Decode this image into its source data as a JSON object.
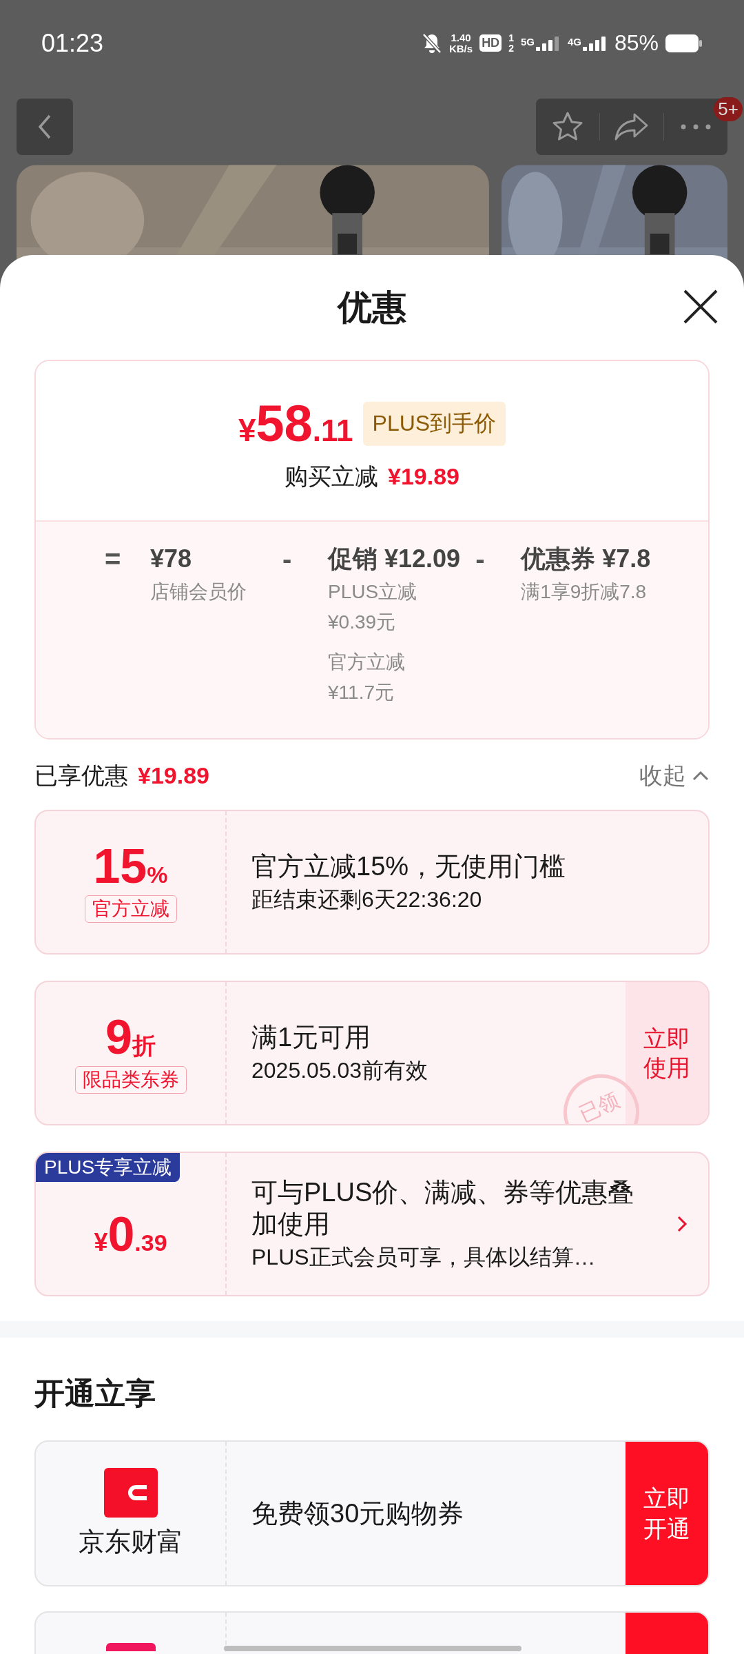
{
  "status_bar": {
    "time": "01:23",
    "net_speed": "1.40",
    "net_unit": "KB/s",
    "hd": "HD",
    "sim_slots": [
      "1",
      "2"
    ],
    "networks": [
      "5G",
      "4G"
    ],
    "battery": "85%"
  },
  "nav": {
    "badge": "5+"
  },
  "sheet": {
    "title": "优惠"
  },
  "price_summary": {
    "currency": "¥",
    "integer": "58",
    "decimal": ".11",
    "tag": "PLUS到手价",
    "saving_label": "购买立减",
    "saving_amount": "¥19.89"
  },
  "breakdown": [
    {
      "operator": "=",
      "value": "¥78",
      "notes": [
        [
          "店铺会员价"
        ]
      ]
    },
    {
      "operator": "-",
      "label": "促销",
      "value": "¥12.09",
      "notes": [
        [
          "PLUS立减",
          "¥0.39元"
        ],
        [
          "官方立减",
          "¥11.7元"
        ]
      ]
    },
    {
      "operator": "-",
      "label": "优惠券",
      "value": "¥7.8",
      "notes": [
        [
          "满1享9折减7.8"
        ]
      ]
    }
  ],
  "enjoyed": {
    "label": "已享优惠",
    "amount": "¥19.89",
    "toggle": "收起",
    "expanded": true
  },
  "coupons": [
    {
      "kind": "percent",
      "value": "15",
      "unit": "%",
      "tag": "官方立减",
      "title": "官方立减15%，无使用门槛",
      "subtitle": "距结束还剩6天22:36:20"
    },
    {
      "kind": "discount",
      "value": "9",
      "unit": "折",
      "tag": "限品类东券",
      "title": "满1元可用",
      "subtitle": "2025.05.03前有效",
      "action": "立即使用",
      "stamp": "已领"
    },
    {
      "kind": "plus",
      "ribbon": "PLUS专享立减",
      "currency": "¥",
      "value": "0",
      "unit": ".39",
      "title": "可与PLUS价、满减、券等优惠叠加使用",
      "subtitle": "PLUS正式会员可享，具体以结算…"
    }
  ],
  "open_section": {
    "title": "开通立享",
    "offers": [
      {
        "name": "京东财富",
        "text": "免费领30元购物券",
        "action": "立即开通",
        "color": "#f5102a"
      },
      {
        "color": "#f0175e"
      }
    ]
  }
}
